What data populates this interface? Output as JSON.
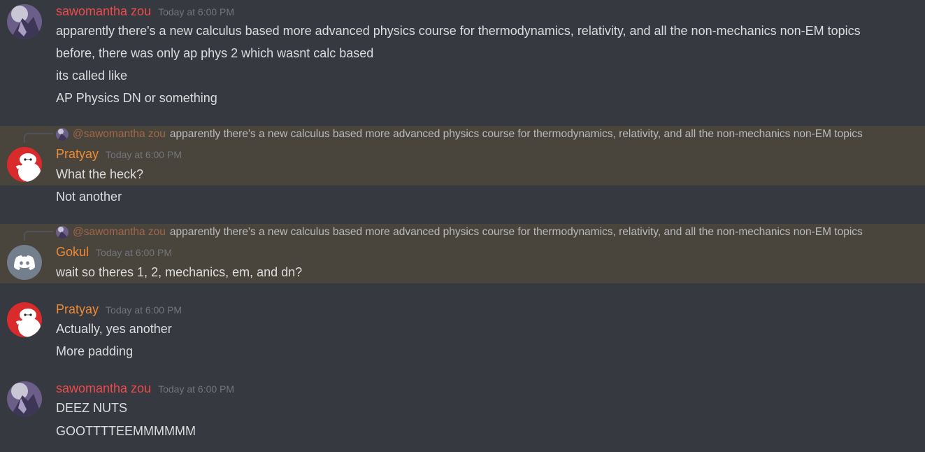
{
  "messages": [
    {
      "author": "sawomantha zou",
      "timestamp": "Today at 6:00 PM",
      "lines": [
        "apparently there's a new calculus based more advanced physics course for thermodynamics, relativity, and all the non-mechanics non-EM topics",
        "before, there was only ap phys 2 which wasnt calc based",
        "its called like",
        "AP Physics DN or something"
      ]
    },
    {
      "reply_mention": "@sawomantha zou",
      "reply_text": "apparently there's a new calculus based more advanced physics course for thermodynamics, relativity, and all the non-mechanics non-EM topics",
      "author": "Pratyay",
      "timestamp": "Today at 6:00 PM",
      "lines": [
        "What the heck?",
        "Not another"
      ]
    },
    {
      "reply_mention": "@sawomantha zou",
      "reply_text": "apparently there's a new calculus based more advanced physics course for thermodynamics, relativity, and all the non-mechanics non-EM topics",
      "author": "Gokul",
      "timestamp": "Today at 6:00 PM",
      "lines": [
        "wait so theres 1, 2, mechanics, em, and dn?"
      ]
    },
    {
      "author": "Pratyay",
      "timestamp": "Today at 6:00 PM",
      "lines": [
        "Actually, yes another",
        "More padding"
      ]
    },
    {
      "author": "sawomantha zou",
      "timestamp": "Today at 6:00 PM",
      "lines": [
        "DEEZ NUTS",
        "GOOTTTTEEMMMMMM"
      ]
    }
  ],
  "colors": {
    "background": "#36393f",
    "mention_highlight": "#49443c",
    "name_red": "#ec4c4c",
    "name_orange": "#ef8a34",
    "text": "#dcddde",
    "timestamp": "#72767d"
  }
}
